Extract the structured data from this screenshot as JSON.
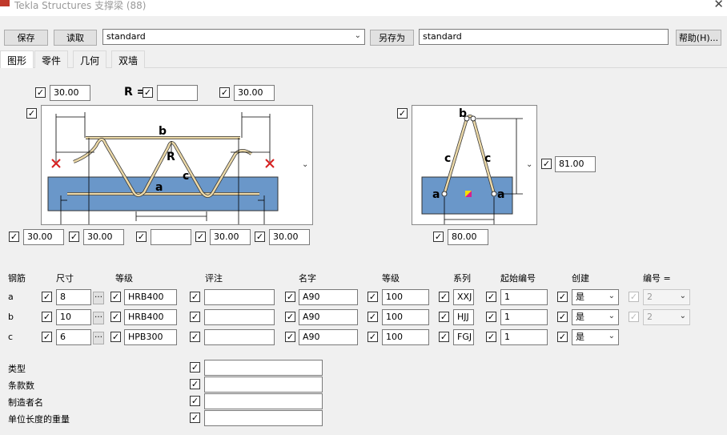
{
  "window": {
    "title": "Tekla Structures  支撑梁 (88)"
  },
  "toolbar": {
    "save": "保存",
    "load": "读取",
    "preset_value": "standard",
    "save_as": "另存为",
    "save_as_value": "standard",
    "help": "帮助(H)..."
  },
  "tabs": [
    "图形",
    "零件",
    "几何",
    "双墙"
  ],
  "diagram": {
    "top_left_value": "30.00",
    "r_label": "R",
    "r_value": "",
    "top_right_value": "30.00",
    "bottom_values": [
      "30.00",
      "30.00",
      "",
      "30.00",
      "30.00"
    ],
    "side_height_value": "81.00",
    "side_width_value": "80.00",
    "labels": {
      "a": "a",
      "b": "b",
      "c": "c",
      "R": "R"
    }
  },
  "rebar_table": {
    "headers": {
      "rebar": "钢筋",
      "size": "尺寸",
      "grade": "等级",
      "comment": "评注",
      "name": "名字",
      "class": "等级",
      "series": "系列",
      "start_no": "起始编号",
      "create": "创建",
      "numbering": "编号 ="
    },
    "rows": [
      {
        "label": "a",
        "size": "8",
        "grade": "HRB400",
        "comment": "",
        "name": "A90",
        "class": "100",
        "series": "XXJ",
        "start_no": "1",
        "create": "是",
        "numbering": "2"
      },
      {
        "label": "b",
        "size": "10",
        "grade": "HRB400",
        "comment": "",
        "name": "A90",
        "class": "100",
        "series": "HJJ",
        "start_no": "1",
        "create": "是",
        "numbering": "2"
      },
      {
        "label": "c",
        "size": "6",
        "grade": "HPB300",
        "comment": "",
        "name": "A90",
        "class": "100",
        "series": "FGJ",
        "start_no": "1",
        "create": "是"
      }
    ]
  },
  "extra": [
    {
      "label": "类型",
      "value": ""
    },
    {
      "label": "条款数",
      "value": ""
    },
    {
      "label": "制造者名",
      "value": ""
    },
    {
      "label": "单位长度的重量",
      "value": ""
    }
  ],
  "icons": {
    "check": "✓",
    "ellipsis": "…",
    "dropdown": "⌄"
  }
}
